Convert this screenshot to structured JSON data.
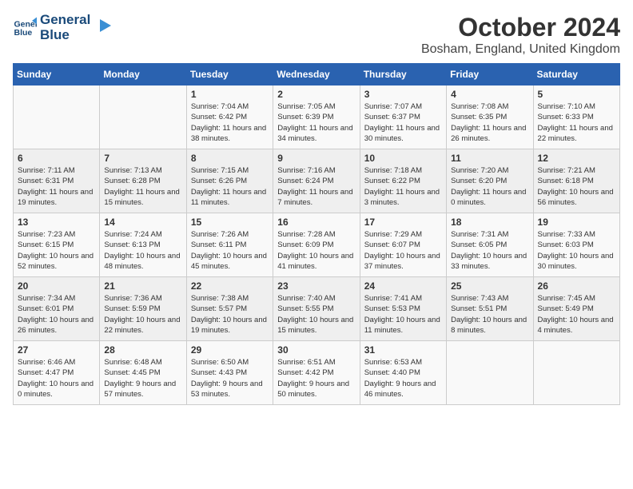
{
  "header": {
    "logo_line1": "General",
    "logo_line2": "Blue",
    "month": "October 2024",
    "location": "Bosham, England, United Kingdom"
  },
  "weekdays": [
    "Sunday",
    "Monday",
    "Tuesday",
    "Wednesday",
    "Thursday",
    "Friday",
    "Saturday"
  ],
  "weeks": [
    [
      {
        "day": "",
        "info": ""
      },
      {
        "day": "",
        "info": ""
      },
      {
        "day": "1",
        "info": "Sunrise: 7:04 AM\nSunset: 6:42 PM\nDaylight: 11 hours and 38 minutes."
      },
      {
        "day": "2",
        "info": "Sunrise: 7:05 AM\nSunset: 6:39 PM\nDaylight: 11 hours and 34 minutes."
      },
      {
        "day": "3",
        "info": "Sunrise: 7:07 AM\nSunset: 6:37 PM\nDaylight: 11 hours and 30 minutes."
      },
      {
        "day": "4",
        "info": "Sunrise: 7:08 AM\nSunset: 6:35 PM\nDaylight: 11 hours and 26 minutes."
      },
      {
        "day": "5",
        "info": "Sunrise: 7:10 AM\nSunset: 6:33 PM\nDaylight: 11 hours and 22 minutes."
      }
    ],
    [
      {
        "day": "6",
        "info": "Sunrise: 7:11 AM\nSunset: 6:31 PM\nDaylight: 11 hours and 19 minutes."
      },
      {
        "day": "7",
        "info": "Sunrise: 7:13 AM\nSunset: 6:28 PM\nDaylight: 11 hours and 15 minutes."
      },
      {
        "day": "8",
        "info": "Sunrise: 7:15 AM\nSunset: 6:26 PM\nDaylight: 11 hours and 11 minutes."
      },
      {
        "day": "9",
        "info": "Sunrise: 7:16 AM\nSunset: 6:24 PM\nDaylight: 11 hours and 7 minutes."
      },
      {
        "day": "10",
        "info": "Sunrise: 7:18 AM\nSunset: 6:22 PM\nDaylight: 11 hours and 3 minutes."
      },
      {
        "day": "11",
        "info": "Sunrise: 7:20 AM\nSunset: 6:20 PM\nDaylight: 11 hours and 0 minutes."
      },
      {
        "day": "12",
        "info": "Sunrise: 7:21 AM\nSunset: 6:18 PM\nDaylight: 10 hours and 56 minutes."
      }
    ],
    [
      {
        "day": "13",
        "info": "Sunrise: 7:23 AM\nSunset: 6:15 PM\nDaylight: 10 hours and 52 minutes."
      },
      {
        "day": "14",
        "info": "Sunrise: 7:24 AM\nSunset: 6:13 PM\nDaylight: 10 hours and 48 minutes."
      },
      {
        "day": "15",
        "info": "Sunrise: 7:26 AM\nSunset: 6:11 PM\nDaylight: 10 hours and 45 minutes."
      },
      {
        "day": "16",
        "info": "Sunrise: 7:28 AM\nSunset: 6:09 PM\nDaylight: 10 hours and 41 minutes."
      },
      {
        "day": "17",
        "info": "Sunrise: 7:29 AM\nSunset: 6:07 PM\nDaylight: 10 hours and 37 minutes."
      },
      {
        "day": "18",
        "info": "Sunrise: 7:31 AM\nSunset: 6:05 PM\nDaylight: 10 hours and 33 minutes."
      },
      {
        "day": "19",
        "info": "Sunrise: 7:33 AM\nSunset: 6:03 PM\nDaylight: 10 hours and 30 minutes."
      }
    ],
    [
      {
        "day": "20",
        "info": "Sunrise: 7:34 AM\nSunset: 6:01 PM\nDaylight: 10 hours and 26 minutes."
      },
      {
        "day": "21",
        "info": "Sunrise: 7:36 AM\nSunset: 5:59 PM\nDaylight: 10 hours and 22 minutes."
      },
      {
        "day": "22",
        "info": "Sunrise: 7:38 AM\nSunset: 5:57 PM\nDaylight: 10 hours and 19 minutes."
      },
      {
        "day": "23",
        "info": "Sunrise: 7:40 AM\nSunset: 5:55 PM\nDaylight: 10 hours and 15 minutes."
      },
      {
        "day": "24",
        "info": "Sunrise: 7:41 AM\nSunset: 5:53 PM\nDaylight: 10 hours and 11 minutes."
      },
      {
        "day": "25",
        "info": "Sunrise: 7:43 AM\nSunset: 5:51 PM\nDaylight: 10 hours and 8 minutes."
      },
      {
        "day": "26",
        "info": "Sunrise: 7:45 AM\nSunset: 5:49 PM\nDaylight: 10 hours and 4 minutes."
      }
    ],
    [
      {
        "day": "27",
        "info": "Sunrise: 6:46 AM\nSunset: 4:47 PM\nDaylight: 10 hours and 0 minutes."
      },
      {
        "day": "28",
        "info": "Sunrise: 6:48 AM\nSunset: 4:45 PM\nDaylight: 9 hours and 57 minutes."
      },
      {
        "day": "29",
        "info": "Sunrise: 6:50 AM\nSunset: 4:43 PM\nDaylight: 9 hours and 53 minutes."
      },
      {
        "day": "30",
        "info": "Sunrise: 6:51 AM\nSunset: 4:42 PM\nDaylight: 9 hours and 50 minutes."
      },
      {
        "day": "31",
        "info": "Sunrise: 6:53 AM\nSunset: 4:40 PM\nDaylight: 9 hours and 46 minutes."
      },
      {
        "day": "",
        "info": ""
      },
      {
        "day": "",
        "info": ""
      }
    ]
  ]
}
